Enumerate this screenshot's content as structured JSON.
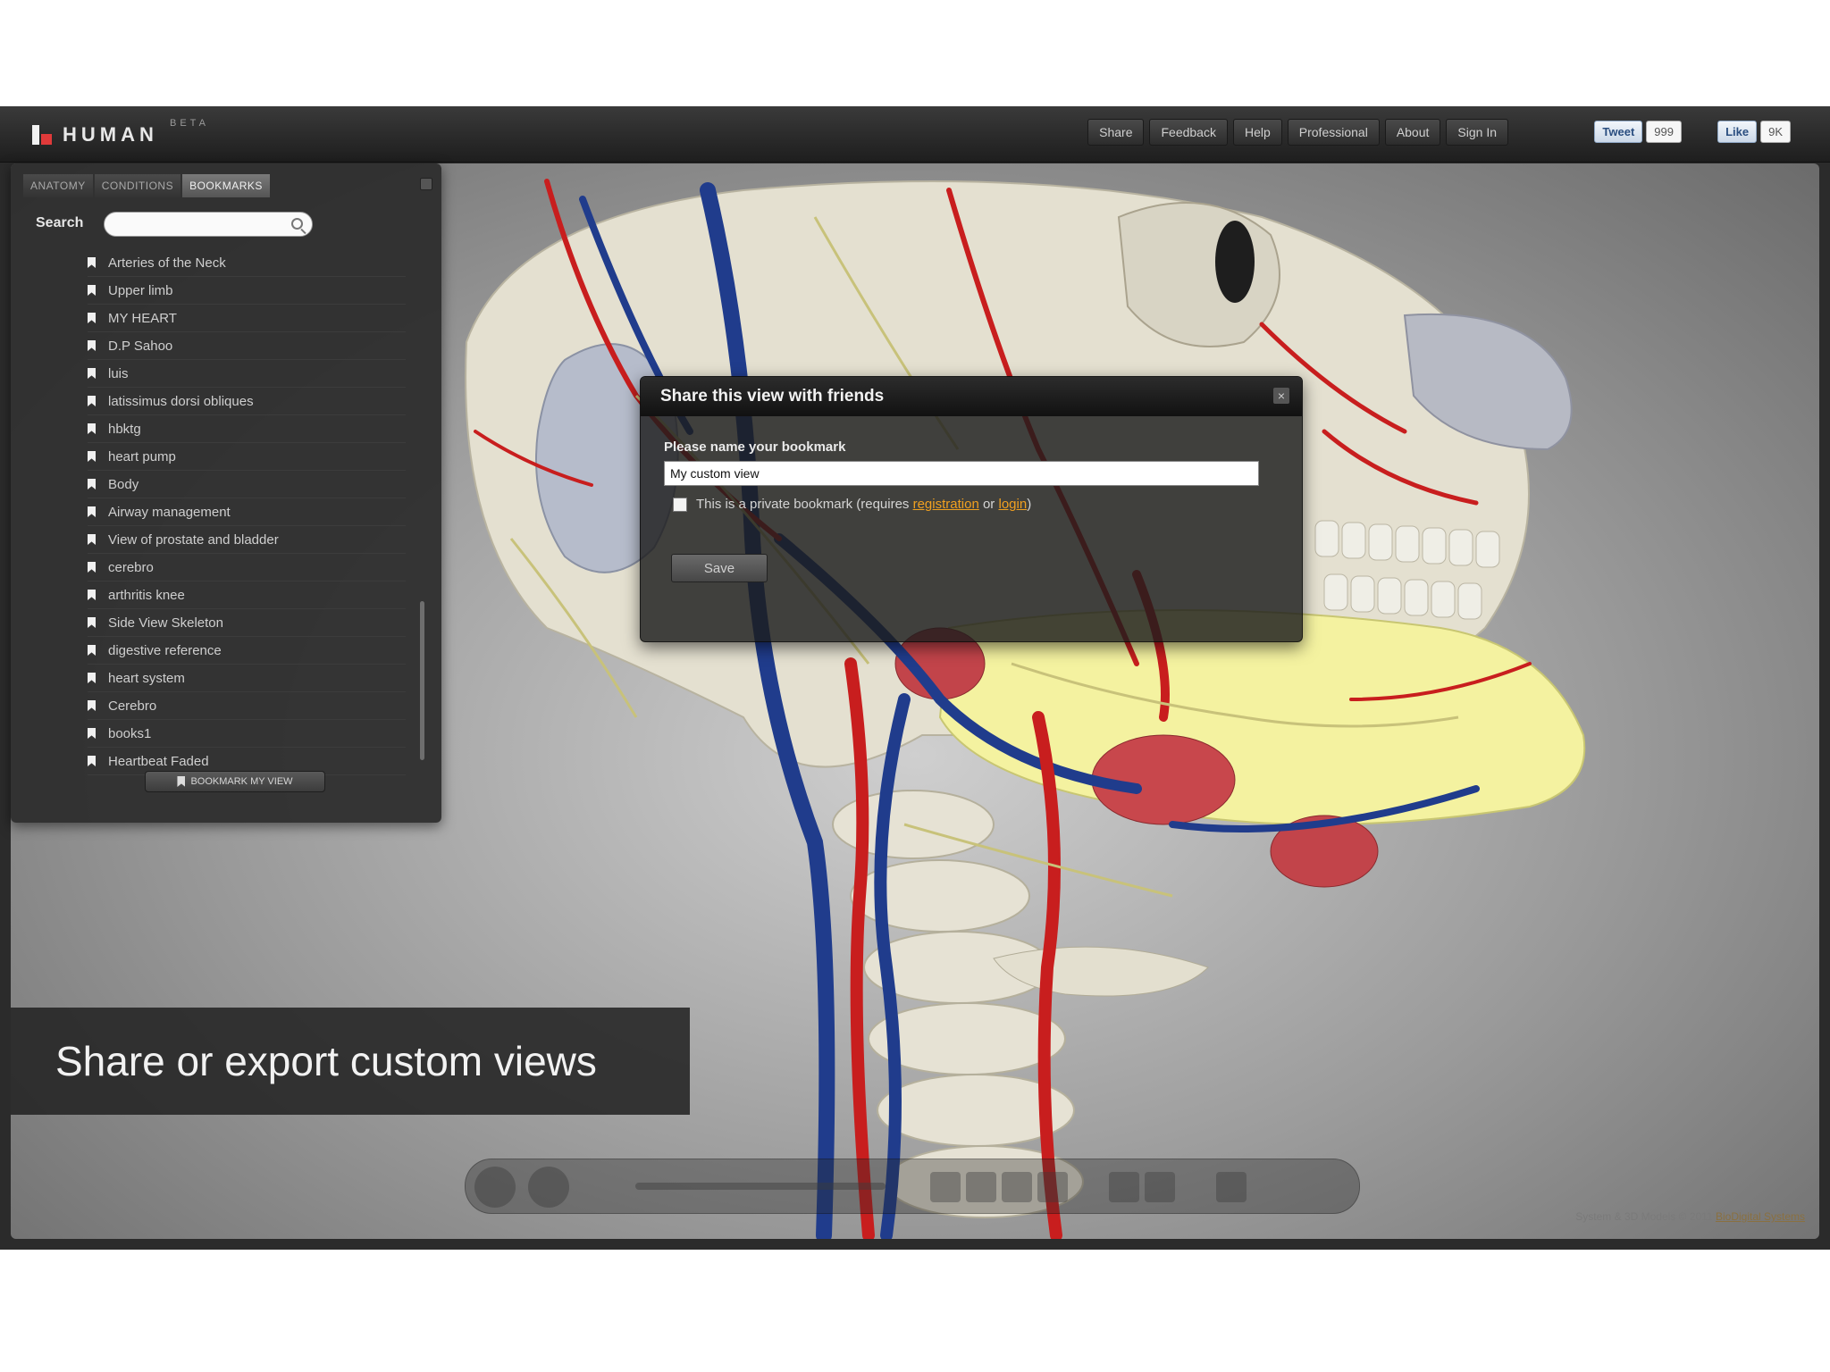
{
  "app": {
    "logo_text": "HUMAN",
    "logo_badge": "BETA"
  },
  "nav": {
    "items": [
      "Share",
      "Feedback",
      "Help",
      "Professional",
      "About",
      "Sign In"
    ]
  },
  "social": {
    "tweet_label": "Tweet",
    "tweet_count": "999",
    "like_label": "Like",
    "like_count": "9K"
  },
  "sidebar": {
    "tabs": [
      "ANATOMY",
      "CONDITIONS",
      "BOOKMARKS"
    ],
    "active_tab": "BOOKMARKS",
    "search_label": "Search",
    "search_placeholder": "",
    "items": [
      "Arteries of the Neck",
      "Upper limb",
      "MY HEART",
      "D.P Sahoo",
      "luis",
      "latissimus dorsi obliques",
      "hbktg",
      "heart pump",
      "Body",
      "Airway management",
      "View of prostate and bladder",
      "cerebro",
      "arthritis knee",
      "Side View Skeleton",
      "digestive reference",
      "heart system",
      "Cerebro",
      "books1",
      "Heartbeat Faded"
    ],
    "bookmark_button": "BOOKMARK MY VIEW"
  },
  "dialog": {
    "title": "Share this view with friends",
    "name_label": "Please name your bookmark",
    "name_value": "My custom view",
    "private_text_prefix": "This is a private bookmark (requires ",
    "registration_link": "registration",
    "or_text": " or ",
    "login_link": "login",
    "private_text_suffix": ")",
    "save_label": "Save",
    "close_glyph": "×"
  },
  "caption": {
    "text": "Share or export custom views"
  },
  "footer": {
    "text": "System & 3D Models © 2011",
    "link": "BioDigital Systems"
  },
  "colors": {
    "accent_link": "#f0a020",
    "artery_red": "#c81e1e",
    "vein_blue": "#203c8c",
    "bone": "#e6e2d4",
    "gland_yellow": "#f4f2a0"
  }
}
